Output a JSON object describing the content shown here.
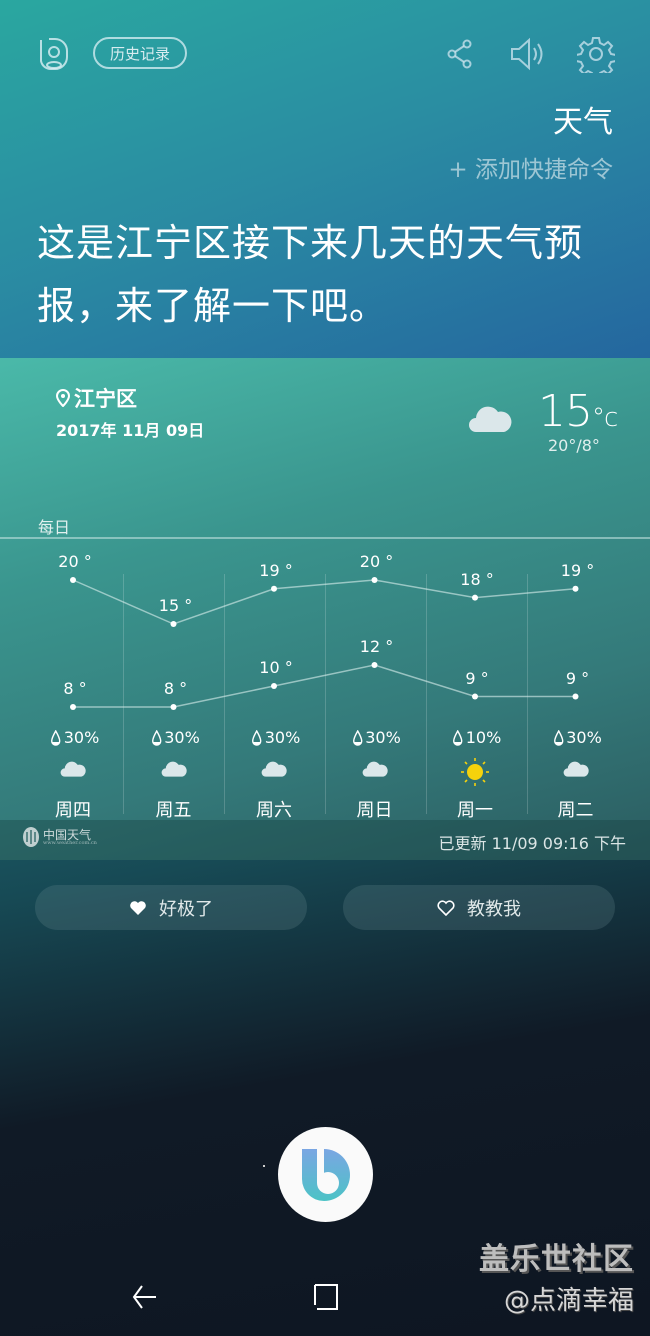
{
  "header": {
    "history_label": "历史记录",
    "title": "天气",
    "add_shortcut_label": "+ 添加快捷命令",
    "icons": [
      "profile-icon",
      "share-icon",
      "volume-icon",
      "gear-icon"
    ]
  },
  "headline": "这是江宁区接下来几天的天气预报，来了解一下吧。",
  "weather_card": {
    "location": "江宁区",
    "date": "2017年 11月 09日",
    "current_temp": "15",
    "current_unit": "°c",
    "current_range": "20°/8°",
    "current_condition_icon": "cloud-icon",
    "daily_label": "每日",
    "days": [
      {
        "day": "周四",
        "high": "20 °",
        "low": "8 °",
        "precip": "30%",
        "icon": "cloud"
      },
      {
        "day": "周五",
        "high": "15 °",
        "low": "8 °",
        "precip": "30%",
        "icon": "cloud"
      },
      {
        "day": "周六",
        "high": "19 °",
        "low": "10 °",
        "precip": "30%",
        "icon": "cloud"
      },
      {
        "day": "周日",
        "high": "20 °",
        "low": "12 °",
        "precip": "30%",
        "icon": "cloud"
      },
      {
        "day": "周一",
        "high": "18 °",
        "low": "9 °",
        "precip": "10%",
        "icon": "sun"
      },
      {
        "day": "周二",
        "high": "19 °",
        "low": "9 °",
        "precip": "30%",
        "icon": "cloud"
      }
    ],
    "provider_name": "中国天气",
    "provider_url": "www.weather.com.cn",
    "updated_text": "已更新  11/09 09:16 下午"
  },
  "chart_data": {
    "type": "line",
    "title": "每日",
    "categories": [
      "周四",
      "周五",
      "周六",
      "周日",
      "周一",
      "周二"
    ],
    "series": [
      {
        "name": "high",
        "values": [
          20,
          15,
          19,
          20,
          18,
          19
        ]
      },
      {
        "name": "low",
        "values": [
          8,
          8,
          10,
          12,
          9,
          9
        ]
      }
    ],
    "precipitation_percent": [
      30,
      30,
      30,
      30,
      10,
      30
    ],
    "unit": "°"
  },
  "feedback": {
    "great_label": "好极了",
    "teach_label": "教教我"
  },
  "watermark": {
    "line1": "盖乐世社区",
    "line2": "@点滴幸福"
  }
}
